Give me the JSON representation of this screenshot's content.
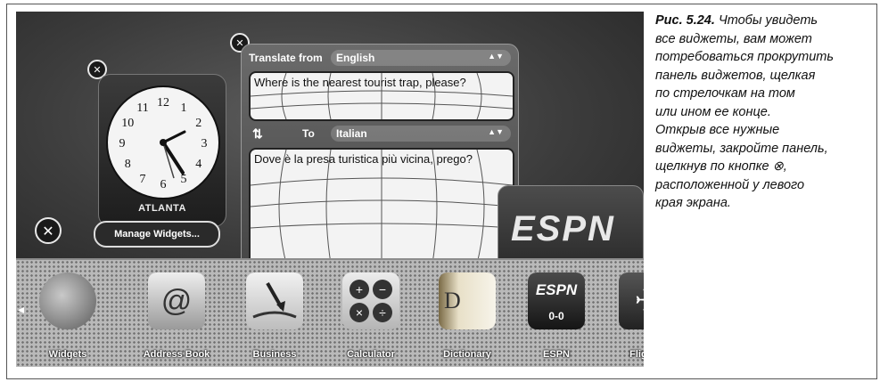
{
  "caption": {
    "label": "Рис. 5.24.",
    "lines": [
      "Чтобы увидеть",
      "все виджеты, вам может",
      "потребоваться прокрутить",
      "панель виджетов, щелкая",
      "по стрелочкам на том",
      "или ином ее конце.",
      "Открыв все нужные",
      "виджеты, закройте панель,",
      "щелкнув по кнопке ⊗,",
      "расположенной у левого",
      "края экрана."
    ]
  },
  "clock": {
    "city": "ATLANTA",
    "numbers": [
      "12",
      "1",
      "2",
      "3",
      "4",
      "5",
      "6",
      "7",
      "8",
      "9",
      "10",
      "11"
    ]
  },
  "manage_widgets": {
    "label": "Manage Widgets..."
  },
  "translator": {
    "from_label": "Translate from",
    "from_lang": "English",
    "source_text": "Where is the nearest tourist trap, please?",
    "to_label": "To",
    "to_lang": "Italian",
    "swap_glyph": "⇅",
    "target_text": "Dove è la presa turistica più vicina, prego?"
  },
  "espn": {
    "logo": "ESPN",
    "score": "0-0"
  },
  "dock": {
    "items": [
      {
        "label": "Widgets"
      },
      {
        "label": "Address Book"
      },
      {
        "label": "Business"
      },
      {
        "label": "Calculator"
      },
      {
        "label": "Dictionary"
      },
      {
        "label": "ESPN"
      },
      {
        "label": "Flight T"
      }
    ]
  }
}
